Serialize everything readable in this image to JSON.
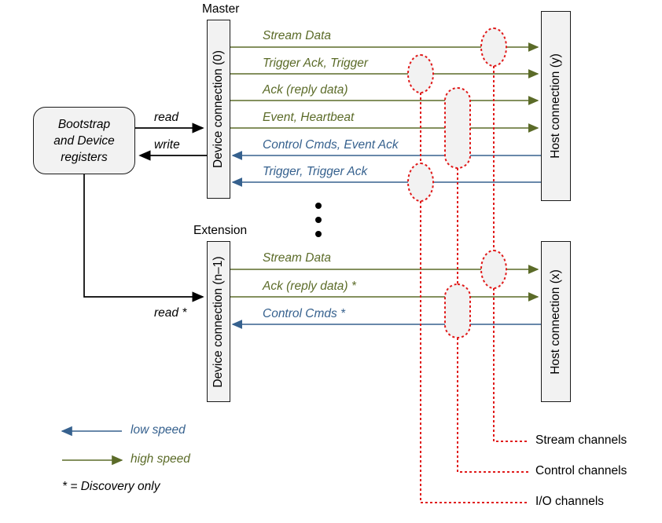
{
  "diagram": {
    "title": "Device / Host connection channel diagram",
    "colors": {
      "high_speed": "#5b6b28",
      "low_speed": "#36618e",
      "channel_marker": "#e01b1b",
      "box_fill": "#f2f2f2",
      "box_stroke": "#1a1a1a",
      "black": "#000000"
    }
  },
  "nodes": {
    "bootstrap": {
      "line1": "Bootstrap",
      "line2": "and Device",
      "line3": "registers"
    },
    "master": {
      "caption": "Master",
      "label": "Device connection (0)"
    },
    "extension": {
      "caption": "Extension",
      "label": "Device connection (n–1)"
    },
    "host_y": {
      "label": "Host connection (y)"
    },
    "host_x": {
      "label": "Host connection (x)"
    }
  },
  "register_flows": [
    {
      "label": "read",
      "direction": "to-device"
    },
    {
      "label": "write",
      "direction": "to-registers"
    },
    {
      "label": "read *",
      "direction": "to-extension"
    }
  ],
  "master_flows": [
    {
      "label": "Stream Data",
      "speed": "high",
      "direction": "right"
    },
    {
      "label": "Trigger Ack, Trigger",
      "speed": "high",
      "direction": "right"
    },
    {
      "label": "Ack (reply data)",
      "speed": "high",
      "direction": "right"
    },
    {
      "label": "Event, Heartbeat",
      "speed": "high",
      "direction": "right"
    },
    {
      "label": "Control Cmds, Event Ack",
      "speed": "low",
      "direction": "left"
    },
    {
      "label": "Trigger, Trigger Ack",
      "speed": "low",
      "direction": "left"
    }
  ],
  "extension_flows": [
    {
      "label": "Stream Data",
      "speed": "high",
      "direction": "right"
    },
    {
      "label": "Ack (reply data) *",
      "speed": "high",
      "direction": "right"
    },
    {
      "label": "Control Cmds *",
      "speed": "low",
      "direction": "left"
    }
  ],
  "continuation": {
    "glyph": "vertical-ellipsis-dots",
    "count": 3
  },
  "legend": {
    "items": [
      {
        "label": "low speed",
        "speed": "low",
        "direction": "left"
      },
      {
        "label": "high speed",
        "speed": "high",
        "direction": "right"
      }
    ],
    "footnote": "* = Discovery only"
  },
  "channel_legend": [
    {
      "label": "Stream channels"
    },
    {
      "label": "Control channels"
    },
    {
      "label": "I/O channels"
    }
  ]
}
